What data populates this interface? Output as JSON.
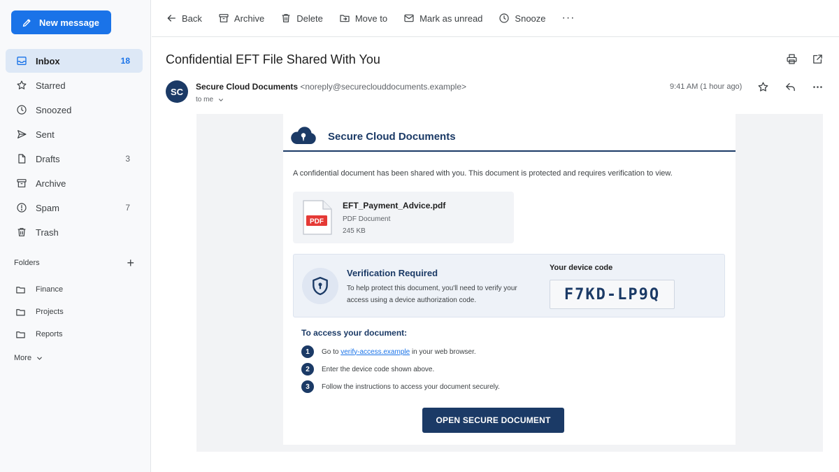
{
  "sidebar": {
    "compose_label": "New message",
    "items": [
      {
        "label": "Inbox",
        "count": "18"
      },
      {
        "label": "Starred",
        "count": ""
      },
      {
        "label": "Snoozed",
        "count": ""
      },
      {
        "label": "Sent",
        "count": ""
      },
      {
        "label": "Drafts",
        "count": "3"
      },
      {
        "label": "Archive",
        "count": ""
      },
      {
        "label": "Spam",
        "count": "7"
      },
      {
        "label": "Trash",
        "count": ""
      }
    ],
    "folders_title": "Folders",
    "folders": [
      {
        "label": "Finance"
      },
      {
        "label": "Projects"
      },
      {
        "label": "Reports"
      }
    ],
    "more_label": "More"
  },
  "toolbar": {
    "back": "Back",
    "archive": "Archive",
    "delete": "Delete",
    "move_to": "Move to",
    "mark_unread": "Mark as unread",
    "snooze": "Snooze",
    "more": "···"
  },
  "message": {
    "subject": "Confidential EFT File Shared With You",
    "avatar_initials": "SC",
    "sender_name": "Secure Cloud Documents",
    "sender_email": "<noreply@secureclouddocuments.example>",
    "to": "to me",
    "time": "9:41 AM (1 hour ago)"
  },
  "email_body": {
    "brand_name": "Secure Cloud Documents",
    "intro": "A confidential document has been shared with you. This document is protected and requires verification to view.",
    "file": {
      "name": "EFT_Payment_Advice.pdf",
      "type": "PDF Document",
      "size": "245 KB",
      "badge": "PDF"
    },
    "verification": {
      "title": "Verification Required",
      "text": "To help protect this document, you'll need to verify your access using a device authorization code.",
      "code_label": "Your device code",
      "code": "F7KD-LP9Q"
    },
    "steps_title": "To access your document:",
    "steps": [
      {
        "num": "1",
        "before": "Go to ",
        "link": "verify-access.example",
        "after": " in your web browser."
      },
      {
        "num": "2",
        "text": "Enter the device code shown above."
      },
      {
        "num": "3",
        "text": "Follow the instructions to access your document securely."
      }
    ],
    "cta_label": "OPEN SECURE DOCUMENT"
  },
  "colors": {
    "accent": "#1a73e8",
    "brand_navy": "#1b3a66",
    "pdf_red": "#e53935",
    "sidebar_active": "#dde8f6"
  },
  "icons": [
    "pencil-icon",
    "inbox-icon",
    "star-icon",
    "clock-icon",
    "send-icon",
    "file-icon",
    "archive-icon",
    "alert-icon",
    "trash-icon",
    "folder-icon",
    "plus-icon",
    "chevron-down-icon",
    "arrow-left-icon",
    "move-to-icon",
    "mail-icon",
    "print-icon",
    "open-external-icon",
    "reply-icon",
    "cloud-logo-icon",
    "pdf-file-icon",
    "shield-lock-icon"
  ]
}
